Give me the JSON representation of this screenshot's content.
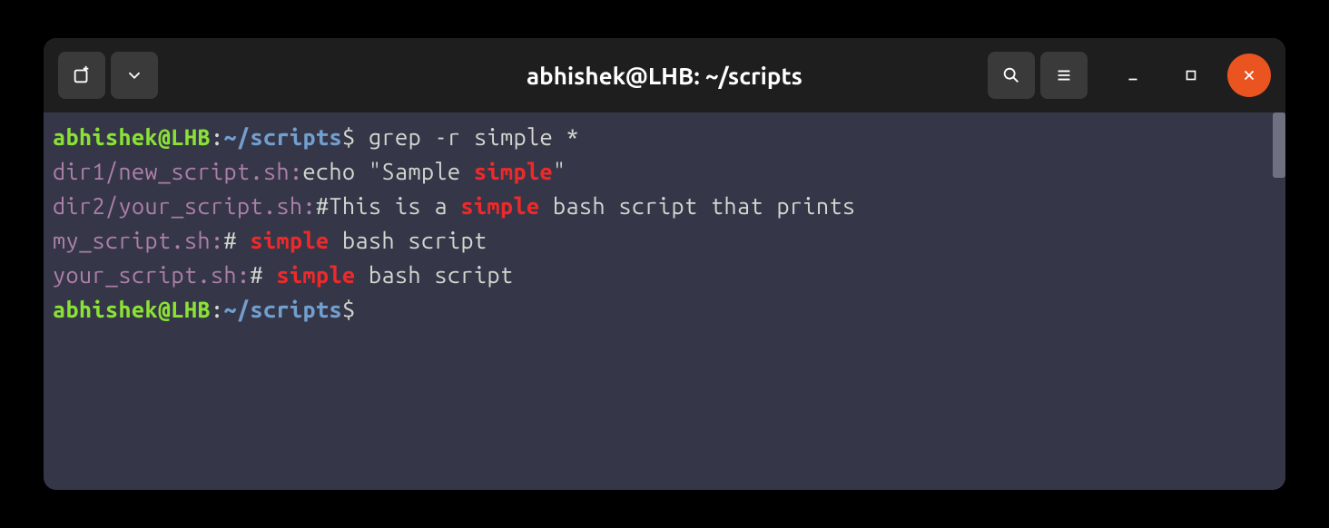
{
  "titlebar": {
    "title": "abhishek@LHB: ~/scripts"
  },
  "prompt": {
    "user_host": "abhishek@LHB",
    "colon": ":",
    "path_prefix": "~",
    "path_tail": "/scripts",
    "dollar": "$"
  },
  "command": " grep -r simple *",
  "results": [
    {
      "file": "dir1/new_script.sh:",
      "before": "echo \"Sample ",
      "match": "simple",
      "after": "\""
    },
    {
      "file": "dir2/your_script.sh:",
      "before": "#This is a ",
      "match": "simple",
      "after": " bash script that prints"
    },
    {
      "file": "my_script.sh:",
      "before": "# ",
      "match": "simple",
      "after": " bash script"
    },
    {
      "file": "your_script.sh:",
      "before": "# ",
      "match": "simple",
      "after": " bash script"
    }
  ]
}
